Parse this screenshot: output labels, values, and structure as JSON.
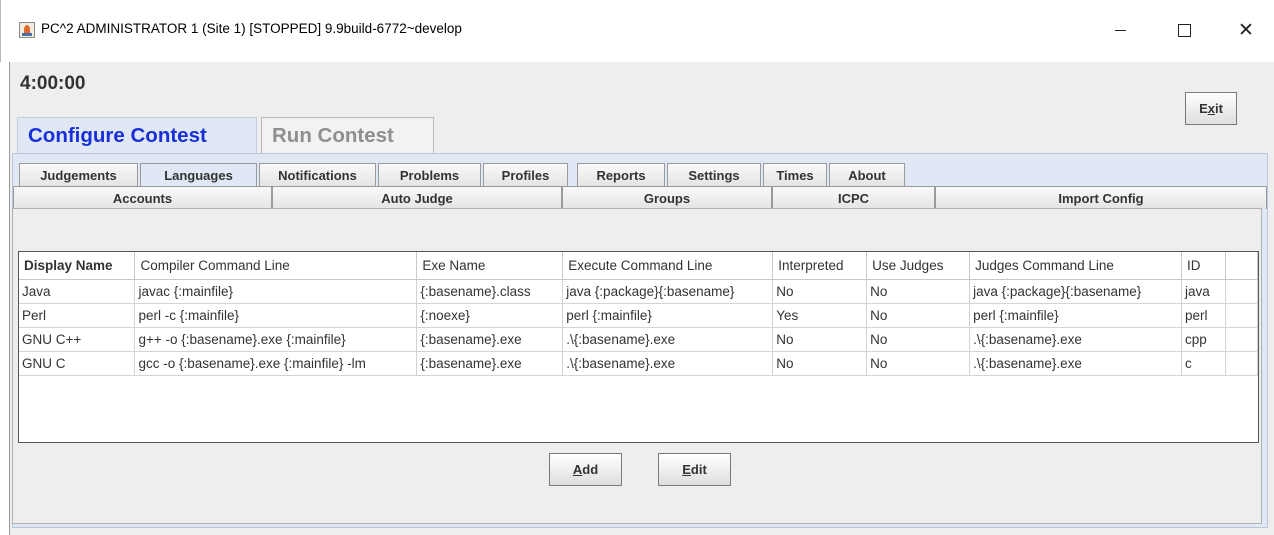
{
  "window": {
    "title": "PC^2 ADMINISTRATOR 1 (Site 1) [STOPPED] 9.9build-6772~develop",
    "minimize_icon": "minimize-icon",
    "maximize_icon": "maximize-icon",
    "close_label": "✕"
  },
  "header": {
    "clock": "4:00:00",
    "exit_letter_1": "E",
    "exit_underlined": "x",
    "exit_rest": "it"
  },
  "top_tabs": {
    "configure": "Configure Contest",
    "run": "Run Contest"
  },
  "sub_tabs_row1": [
    "Judgements",
    "Languages",
    "Notifications",
    "Problems",
    "Profiles",
    "Reports",
    "Settings",
    "Times",
    "About"
  ],
  "sub_tabs_row2": [
    "Accounts",
    "Auto Judge",
    "Groups",
    "ICPC",
    "Import Config"
  ],
  "selected_sub_tab": "Languages",
  "languages_table": {
    "columns": [
      "Display Name",
      "Compiler Command Line",
      "Exe Name",
      "Execute Command Line",
      "Interpreted",
      "Use Judges",
      "Judges Command Line",
      "ID",
      ""
    ],
    "rows": [
      [
        "Java",
        "javac {:mainfile}",
        "{:basename}.class",
        "java {:package}{:basename}",
        "No",
        "No",
        "java {:package}{:basename}",
        "java",
        ""
      ],
      [
        "Perl",
        "perl -c {:mainfile}",
        "{:noexe}",
        "perl {:mainfile}",
        "Yes",
        "No",
        "perl {:mainfile}",
        "perl",
        ""
      ],
      [
        "GNU C++",
        "g++ -o {:basename}.exe {:mainfile}",
        "{:basename}.exe",
        ".\\{:basename}.exe",
        "No",
        "No",
        ".\\{:basename}.exe",
        "cpp",
        ""
      ],
      [
        "GNU C",
        "gcc -o {:basename}.exe {:mainfile} -lm",
        "{:basename}.exe",
        ".\\{:basename}.exe",
        "No",
        "No",
        ".\\{:basename}.exe",
        "c",
        ""
      ]
    ]
  },
  "buttons": {
    "add_underlined": "A",
    "add_rest": "dd",
    "edit_underlined": "E",
    "edit_rest": "dit"
  },
  "colors": {
    "active_tab_text": "#1a2fd8",
    "panel_background": "#dfe8f4"
  }
}
